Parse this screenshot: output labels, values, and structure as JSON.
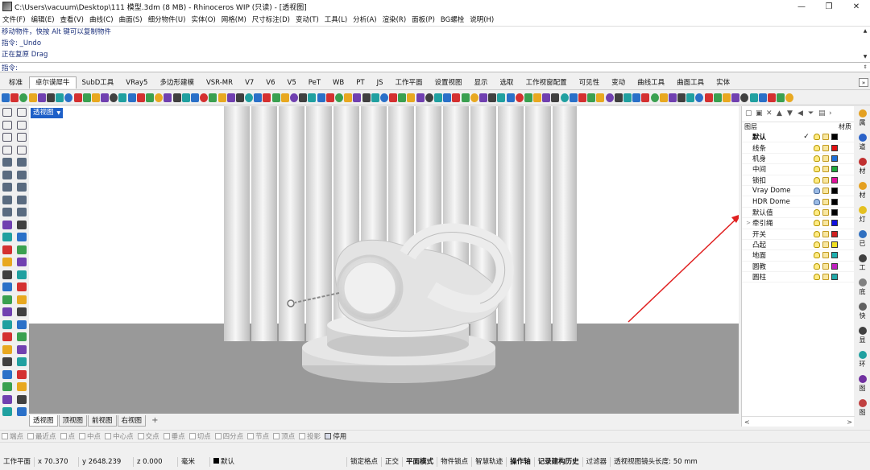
{
  "window": {
    "title": "C:\\Users\\vacuum\\Desktop\\111 模型.3dm (8 MB) - Rhinoceros WIP (只读) - [透视图]",
    "minimize": "—",
    "maximize": "❐",
    "close": "✕"
  },
  "menu": [
    "文件(F)",
    "编辑(E)",
    "查看(V)",
    "曲线(C)",
    "曲面(S)",
    "细分物件(U)",
    "实体(O)",
    "网格(M)",
    "尺寸标注(D)",
    "变动(T)",
    "工具(L)",
    "分析(A)",
    "渲染(R)",
    "面板(P)",
    "BG螺栓",
    "说明(H)"
  ],
  "command_history": [
    "移动物件，快按 Alt 键可以复制物件",
    "指令: _Undo",
    "正在复原 Drag"
  ],
  "command_prompt": "指令:",
  "toolbar_tabs": {
    "items": [
      "标准",
      "卓尔谟犀牛",
      "SubD工具",
      "VRay5",
      "多边形建模",
      "VSR-MR",
      "V7",
      "V6",
      "V5",
      "PeT",
      "WB",
      "PT",
      "JS",
      "工作平面",
      "设置视图",
      "显示",
      "选取",
      "工作视窗配置",
      "可见性",
      "变动",
      "曲线工具",
      "曲面工具",
      "实体"
    ],
    "active_index": 1,
    "more": "»"
  },
  "viewport": {
    "label": "透视图",
    "tabs": [
      "透视图",
      "顶视图",
      "前视图",
      "右视图"
    ],
    "add_tab": "+"
  },
  "layers_panel": {
    "header_layer": "图层",
    "header_material": "材质",
    "current_check": "✓",
    "expand_arrow": ">",
    "rows": [
      {
        "name": "默认",
        "color": "#000000",
        "current": true,
        "expand": false
      },
      {
        "name": "线条",
        "color": "#e01010",
        "current": false,
        "expand": false
      },
      {
        "name": "机身",
        "color": "#1e6fd8",
        "current": false,
        "expand": false
      },
      {
        "name": "中间",
        "color": "#1ea83c",
        "current": false,
        "expand": false
      },
      {
        "name": "锁扣",
        "color": "#e0109b",
        "current": false,
        "expand": false
      },
      {
        "name": "Vray Dome",
        "color": "#000000",
        "current": false,
        "expand": false
      },
      {
        "name": "HDR Dome",
        "color": "#000000",
        "current": false,
        "expand": false
      },
      {
        "name": "默认值",
        "color": "#000000",
        "current": false,
        "expand": false
      },
      {
        "name": "牵引绳",
        "color": "#1010e0",
        "current": false,
        "expand": true
      },
      {
        "name": "开关",
        "color": "#d02020",
        "current": false,
        "expand": false
      },
      {
        "name": "凸起",
        "color": "#f0e020",
        "current": false,
        "expand": false
      },
      {
        "name": "地面",
        "color": "#20b0b0",
        "current": false,
        "expand": false
      },
      {
        "name": "圆教",
        "color": "#c020c0",
        "current": false,
        "expand": false
      },
      {
        "name": "圆柱",
        "color": "#20a8a8",
        "current": false,
        "expand": false
      }
    ],
    "scroll_left": "<",
    "scroll_right": ">"
  },
  "side_tabs": [
    {
      "label": "属",
      "icon": "#e4a020"
    },
    {
      "label": "道",
      "icon": "#2a62c8"
    },
    {
      "label": "材",
      "icon": "#c03030"
    },
    {
      "label": "材",
      "icon": "#e4a020"
    },
    {
      "label": "灯",
      "icon": "#e4c020"
    },
    {
      "label": "已",
      "icon": "#3070c0"
    },
    {
      "label": "工",
      "icon": "#404040"
    },
    {
      "label": "底",
      "icon": "#808080"
    },
    {
      "label": "快",
      "icon": "#606060"
    },
    {
      "label": "显",
      "icon": "#404040"
    },
    {
      "label": "环",
      "icon": "#20a0a0"
    },
    {
      "label": "图",
      "icon": "#7030a0"
    },
    {
      "label": "图",
      "icon": "#c04040"
    }
  ],
  "osnap": {
    "items": [
      {
        "label": "端点",
        "checked": false
      },
      {
        "label": "最近点",
        "checked": false
      },
      {
        "label": "点",
        "checked": false
      },
      {
        "label": "中点",
        "checked": false
      },
      {
        "label": "中心点",
        "checked": false
      },
      {
        "label": "交点",
        "checked": false
      },
      {
        "label": "垂点",
        "checked": false
      },
      {
        "label": "切点",
        "checked": false
      },
      {
        "label": "四分点",
        "checked": false
      },
      {
        "label": "节点",
        "checked": false
      },
      {
        "label": "顶点",
        "checked": false
      },
      {
        "label": "投影",
        "checked": false
      },
      {
        "label": "停用",
        "checked": true
      }
    ]
  },
  "status": {
    "cplane": "工作平面",
    "x": "x 70.370",
    "y": "y 2648.239",
    "z": "z 0.000",
    "units": "毫米",
    "layer": "默认",
    "grid_snap": "锁定格点",
    "ortho": "正交",
    "planar": "平面模式",
    "osnap": "物件锁点",
    "smart_track": "智慧轨迹",
    "gumball": "操作轴",
    "history": "记录建构历史",
    "filter": "过滤器",
    "camera": "透视视图镜头长度: 50 mm"
  },
  "icon_colors": [
    "#2a70c8",
    "#d43030",
    "#3aa050",
    "#e8a820",
    "#7040b0",
    "#404040",
    "#20a0a0"
  ]
}
